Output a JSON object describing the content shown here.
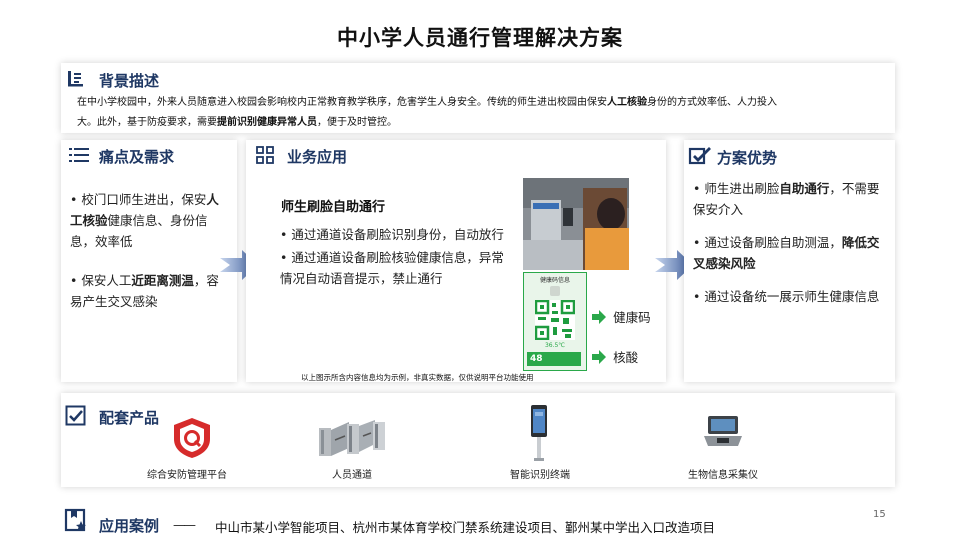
{
  "title": "中小学人员通行管理解决方案",
  "background": {
    "heading": "背景描述",
    "line1": "在中小学校园中，外来人员随意进入校园会影响校内正常教育教学秩序，危害学生人身安全。传统的师生进出校园由保安",
    "line1_bold": "人工核验",
    "line1_tail": "身份的方式效率低、人力投入",
    "line2_a": "大。此外，基于防疫要求，需要",
    "line2_bold": "提前识别健康异常人员",
    "line2_b": "，便于及时管控。"
  },
  "pain": {
    "heading": "痛点及需求",
    "item1_a": "校门口师生进出，保安",
    "item1_bold": "人工核验",
    "item1_b": "健康信息、身份信息，效率低",
    "item2_a": "保安人工",
    "item2_bold": "近距离测温",
    "item2_b": "，容易产生交叉感染"
  },
  "business": {
    "heading": "业务应用",
    "subtitle": "师生刷脸自助通行",
    "item1": "通过通道设备刷脸识别身份，自动放行",
    "item2": "通过通道设备刷脸核验健康信息，异常情况自动语音提示，禁止通行",
    "label_health": "健康码",
    "label_nucleic": "核酸",
    "phone_title": "健康码信息",
    "phone_temp": "36.5℃",
    "phone_num": "48",
    "note": "以上图示所含内容信息均为示例，非真实数据，仅供说明平台功能使用"
  },
  "advantages": {
    "heading": "方案优势",
    "item1_a": "师生进出刷脸",
    "item1_bold": "自助通行",
    "item1_b": "，不需要保安介入",
    "item2_a": "通过设备刷脸自助测温，",
    "item2_bold": "降低交叉感染风险",
    "item3": "通过设备统一展示师生健康信息"
  },
  "products": {
    "heading": "配套产品",
    "items": [
      {
        "label": "综合安防管理平台",
        "icon": "platform-logo"
      },
      {
        "label": "人员通道",
        "icon": "turnstile"
      },
      {
        "label": "智能识别终端",
        "icon": "face-terminal"
      },
      {
        "label": "生物信息采集仪",
        "icon": "bio-collector"
      }
    ]
  },
  "cases": {
    "heading": "应用案例",
    "dash": "——",
    "text": "中山市某小学智能项目、杭州市某体育学校门禁系统建设项目、鄞州某中学出入口改造项目"
  },
  "page_number": "15",
  "colors": {
    "heading": "#1f3864",
    "arrow": "#4a6aa5",
    "green": "#2aa84a",
    "red": "#d62b2b"
  }
}
